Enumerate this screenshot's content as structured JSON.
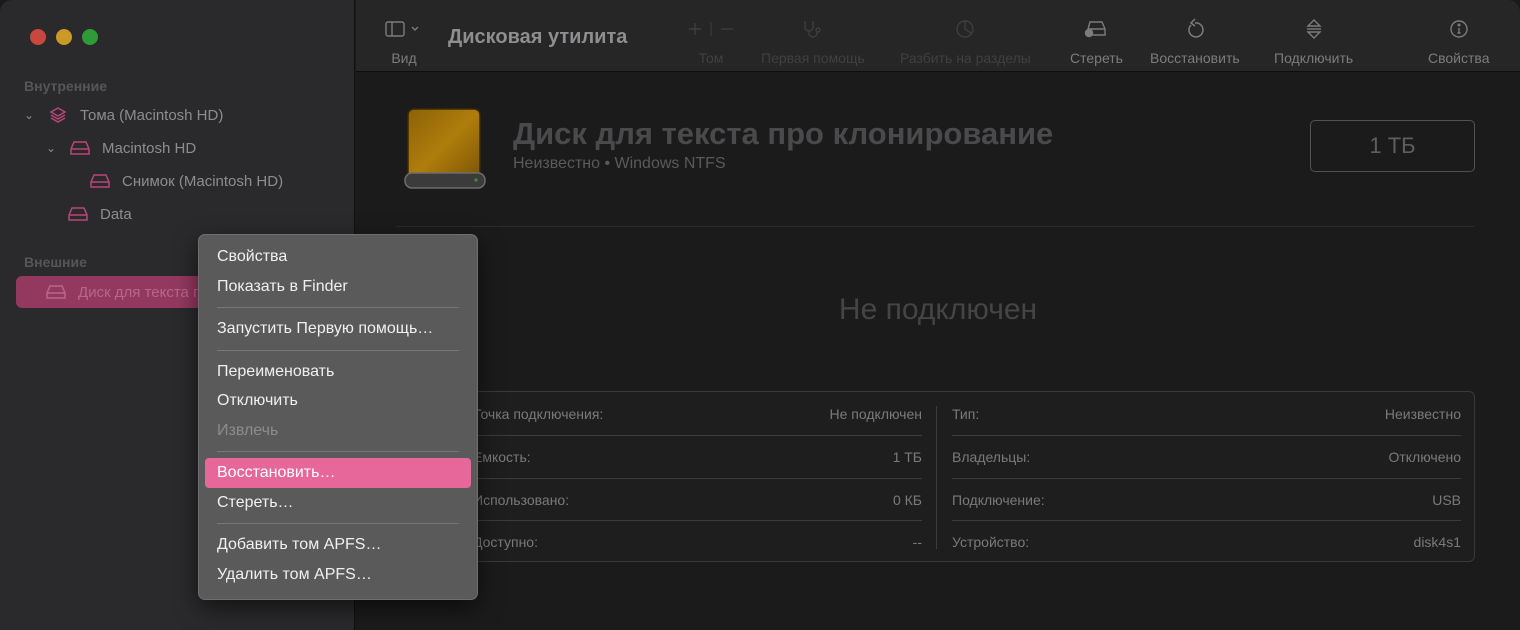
{
  "window": {
    "app_title": "Дисковая утилита",
    "traffic_lights": {
      "close": "#c9473f",
      "minimize": "#c99a26",
      "zoom": "#2f9b38"
    }
  },
  "sidebar": {
    "section_internal": "Внутренние",
    "section_external": "Внешние",
    "internal_items": [
      {
        "label": "Тома (Macintosh HD)",
        "icon": "layers-icon",
        "expanded": true
      },
      {
        "label": "Macintosh HD",
        "icon": "drive-icon",
        "expanded": true
      },
      {
        "label": "Снимок (Macintosh HD)",
        "icon": "drive-icon"
      },
      {
        "label": "Data",
        "icon": "drive-icon"
      }
    ],
    "external_items": [
      {
        "label": "Диск для текста про клонирование",
        "icon": "drive-icon",
        "selected": true
      }
    ]
  },
  "toolbar": {
    "view_label": "Вид",
    "volume_label": "Том",
    "first_aid_label": "Первая помощь",
    "partition_label": "Разбить на разделы",
    "erase_label": "Стереть",
    "restore_label": "Восстановить",
    "mount_label": "Подключить",
    "info_label": "Свойства"
  },
  "disk": {
    "name": "Диск для текста про клонирование",
    "subtitle": "Неизвестно • Windows NTFS",
    "size": "1 ТБ",
    "status": "Не подключен"
  },
  "info": {
    "left": [
      {
        "label": "Точка подключения:",
        "value": "Не подключен"
      },
      {
        "label": "Емкость:",
        "value": "1 ТБ"
      },
      {
        "label": "Использовано:",
        "value": "0 КБ"
      },
      {
        "label": "Доступно:",
        "value": "--"
      }
    ],
    "right": [
      {
        "label": "Тип:",
        "value": "Неизвестно"
      },
      {
        "label": "Владельцы:",
        "value": "Отключено"
      },
      {
        "label": "Подключение:",
        "value": "USB"
      },
      {
        "label": "Устройство:",
        "value": "disk4s1"
      }
    ]
  },
  "context_menu": {
    "items": [
      {
        "label": "Свойства"
      },
      {
        "label": "Показать в Finder"
      },
      {
        "label": "Запустить Первую помощь…"
      },
      {
        "label": "Переименовать"
      },
      {
        "label": "Отключить"
      },
      {
        "label": "Извлечь",
        "disabled": true
      },
      {
        "label": "Восстановить…",
        "highlighted": true
      },
      {
        "label": "Стереть…"
      },
      {
        "label": "Добавить том APFS…"
      },
      {
        "label": "Удалить том APFS…"
      }
    ],
    "highlight_color": "#e8679b"
  }
}
